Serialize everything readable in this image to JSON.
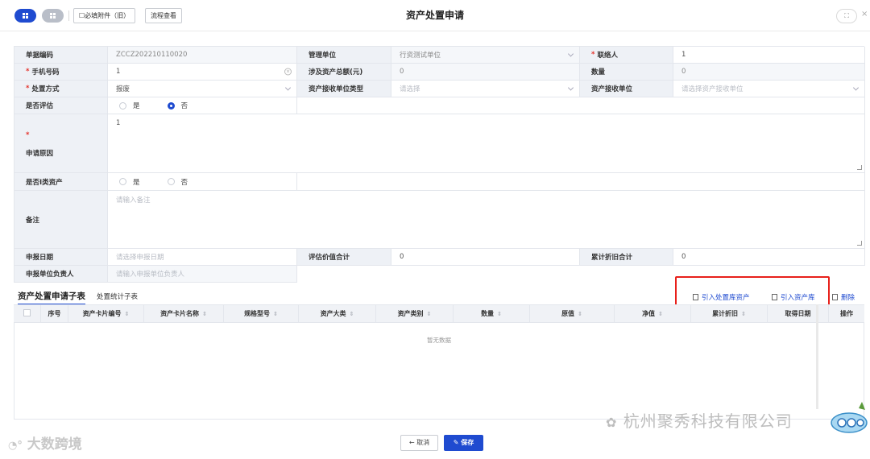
{
  "toolbar": {
    "attachment_label": "☐必填附件（旧）",
    "flow_label": "流程查看",
    "title": "资产处置申请",
    "expand_glyph": "⛶",
    "close_glyph": "×"
  },
  "form": {
    "doc_code": {
      "label": "单据编码",
      "value": "ZCCZ202210110020"
    },
    "mgmt_unit": {
      "label": "管理单位",
      "value": "行资测试单位"
    },
    "contact": {
      "label": "联络人",
      "value": "1"
    },
    "phone": {
      "label": "手机号码",
      "value": "1"
    },
    "total_amount": {
      "label": "涉及资产总额(元)",
      "value": "0"
    },
    "quantity": {
      "label": "数量",
      "value": "0"
    },
    "disposal_method": {
      "label": "处置方式",
      "value": "报废"
    },
    "receiver_type": {
      "label": "资产接收单位类型",
      "placeholder": "请选择"
    },
    "receiver_unit": {
      "label": "资产接收单位",
      "placeholder": "请选择资产接收单位"
    },
    "is_evaluated": {
      "label": "是否评估",
      "option_yes": "是",
      "option_no": "否",
      "selected": "否"
    },
    "reason": {
      "label": "申请原因",
      "value": "1"
    },
    "is_class1": {
      "label": "是否Ⅰ类资产",
      "option_yes": "是",
      "option_no": "否"
    },
    "remark": {
      "label": "备注",
      "placeholder": "请输入备注"
    },
    "report_date": {
      "label": "申报日期",
      "placeholder": "请选择申报日期"
    },
    "eval_total": {
      "label": "评估价值合计",
      "value": "0"
    },
    "depr_total": {
      "label": "累计折旧合计",
      "value": "0"
    },
    "unit_manager": {
      "label": "申报单位负责人",
      "placeholder": "请输入申报单位负责人"
    }
  },
  "subtable": {
    "tab_active": "资产处置申请子表",
    "tab_other": "处置统计子表",
    "import_disposal": "引入处置库资产",
    "import_asset": "引入资产库",
    "delete": "删除",
    "columns": [
      "序号",
      "资产卡片编号",
      "资产卡片名称",
      "规格型号",
      "资产大类",
      "资产类别",
      "数量",
      "原值",
      "净值",
      "累计折旧",
      "取得日期",
      "操作"
    ],
    "empty_text": "暂无数据"
  },
  "footer": {
    "cancel_label": "← 取消",
    "save_label": "✎ 保存"
  },
  "watermark": {
    "left": "大数跨境",
    "right": "杭州聚秀科技有限公司"
  },
  "colors": {
    "primary": "#1f4bd0",
    "highlight": "#e8201a",
    "label_bg": "#eef1f6"
  }
}
